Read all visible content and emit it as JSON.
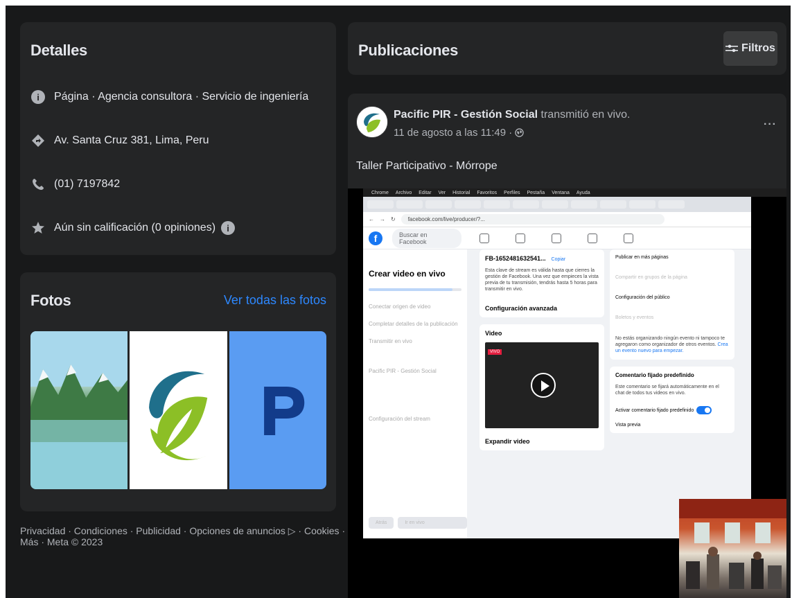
{
  "details": {
    "title": "Detalles",
    "page_type": "Página · Agencia consultora · Servicio de ingeniería",
    "address": "Av. Santa Cruz 381, Lima, Peru",
    "phone": "(01) 7197842",
    "rating": "Aún sin calificación (0 opiniones)"
  },
  "photos": {
    "title": "Fotos",
    "see_all": "Ver todas las fotos",
    "items": [
      "landscape",
      "logo",
      "P"
    ]
  },
  "footer": {
    "text": "Privacidad · Condiciones · Publicidad · Opciones de anuncios ▷ · Cookies · Más · Meta © 2023"
  },
  "posts_header": {
    "title": "Publicaciones",
    "filters_label": "Filtros"
  },
  "post": {
    "author": "Pacific PIR - Gestión Social",
    "action": "transmitió en vivo.",
    "date": "11 de agosto a las 11:49 ·",
    "text": "Taller Participativo - Mórrope",
    "more": "···"
  },
  "video": {
    "mac_menu": [
      "Chrome",
      "Archivo",
      "Editar",
      "Ver",
      "Historial",
      "Favoritos",
      "Perfiles",
      "Pestaña",
      "Ventana",
      "Ayuda"
    ],
    "browser_url": "facebook.com/live/producer/?...",
    "fb_search": "Buscar en Facebook",
    "left_title": "Crear video en vivo",
    "steps": [
      "Conectar origen de video",
      "Completar detalles de la publicación",
      "Transmitir en vivo"
    ],
    "left_page_label": "Pacific PIR - Gestión Social",
    "left_cfg": "Configuración del stream",
    "left_btn_back": "Atrás",
    "left_btn_go": "Ir en vivo",
    "stream_key": "FB-1652481632541...",
    "copy_label": "Copiar",
    "stream_key_note": "Esta clave de stream es válida hasta que cierres la gestión de Facebook. Una vez que empieces la vista previa de tu transmisión, tendrás hasta 5 horas para transmitir en vivo.",
    "advanced": "Configuración avanzada",
    "video_label": "Video",
    "vivo_badge": "VIVO",
    "expand": "Expandir video",
    "publish_more": "Publicar en más páginas",
    "share_groups": "Compartir en grupos de la página",
    "audience": "Configuración del público",
    "events": "Boletos y eventos",
    "events_note": "No estás organizando ningún evento ni tampoco te agregaron como organizador de otros eventos.",
    "events_link": "Crea un evento nuevo para empezar.",
    "pinned_title": "Comentario fijado predefinido",
    "pinned_note": "Este comentario se fijará automáticamente en el chat de todos tus videos en vivo.",
    "pinned_toggle": "Activar comentario fijado predefinido",
    "preview": "Vista previa"
  },
  "colors": {
    "bg": "#18191a",
    "card": "#242526",
    "text": "#e4e6eb",
    "muted": "#b0b3b8",
    "link": "#2d88ff"
  }
}
